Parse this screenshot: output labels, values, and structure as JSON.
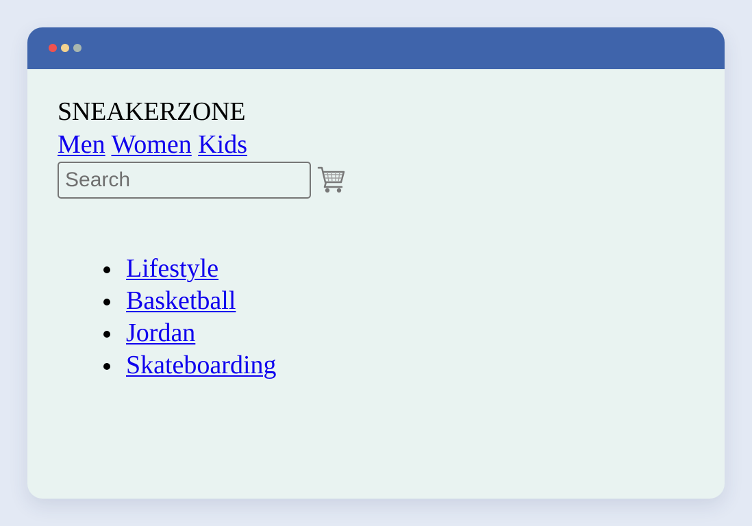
{
  "brand": {
    "name": "SNEAKERZONE"
  },
  "nav": {
    "items": [
      {
        "label": "Men"
      },
      {
        "label": "Women"
      },
      {
        "label": "Kids"
      }
    ]
  },
  "search": {
    "placeholder": "Search",
    "value": ""
  },
  "cart": {
    "icon": "shopping-cart-icon"
  },
  "categories": [
    {
      "label": "Lifestyle"
    },
    {
      "label": "Basketball"
    },
    {
      "label": "Jordan"
    },
    {
      "label": "Skateboarding"
    }
  ],
  "colors": {
    "titlebar": "#3f64ab",
    "link": "#0f00ee",
    "window_background": "#e9f3f1",
    "frame_background": "#e3e9f4"
  }
}
